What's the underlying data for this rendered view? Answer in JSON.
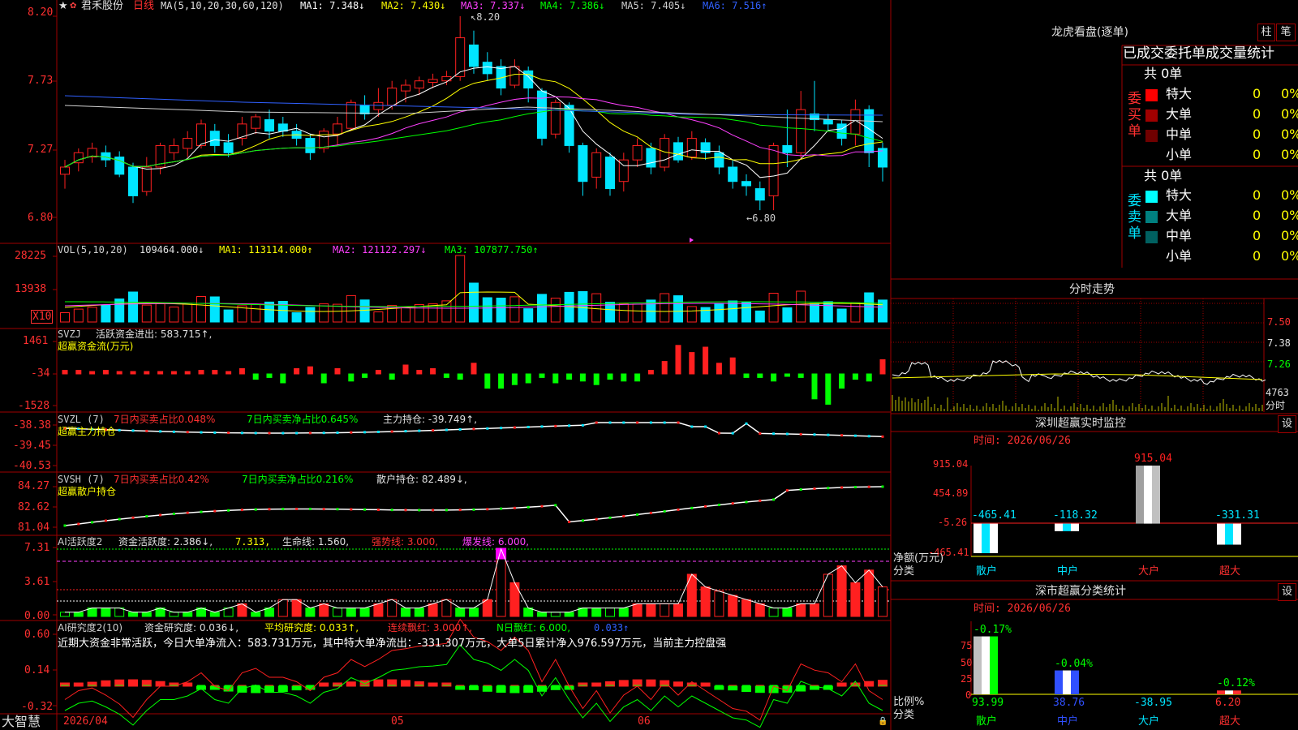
{
  "colors": {
    "up": "#ff2020",
    "down": "#00e5ff",
    "ma1": "#ffffff",
    "ma2": "#ffff00",
    "ma3": "#ff40ff",
    "ma4": "#00ff00",
    "ma5": "#d0d0d0",
    "ma6": "#3060ff",
    "grid": "#a00000",
    "axis_text": "#ff3030",
    "green": "#00ff00"
  },
  "kline": {
    "header": {
      "stock_name": "君禾股份",
      "period": "日线",
      "ma_spec": "MA(5,10,20,30,60,120)",
      "ma1": "MA1: 7.348↓",
      "ma2": "MA2: 7.430↓",
      "ma3": "MA3: 7.337↓",
      "ma4": "MA4: 7.386↓",
      "ma5": "MA5: 7.405↓",
      "ma6": "MA6: 7.516↑"
    },
    "y_ticks": [
      "8.20",
      "7.73",
      "7.27",
      "6.80"
    ],
    "high_label": "8.20",
    "low_label": "6.80",
    "x_labels": [
      "2026/04",
      "05",
      "06"
    ],
    "footer_left": "大智慧"
  },
  "vol": {
    "header": "VOL(5,10,20)",
    "value": "109464.000↓",
    "ma1": "MA1: 113114.000↑",
    "ma2": "MA2: 121122.297↓",
    "ma3": "MA3: 107877.750↑",
    "y_ticks": [
      "28225",
      "13938"
    ],
    "unit": "X10"
  },
  "svzj": {
    "header": "SVZJ",
    "line1": "活跃资金进出: 583.715↑,",
    "line2": "超赢资金流(万元)",
    "y_ticks": [
      "1461",
      "-34",
      "-1528"
    ]
  },
  "svzl": {
    "header": "SVZL (7)",
    "a": "7日内买卖占比0.048%",
    "b": "7日内买卖净占比0.645%",
    "c": "主力持仓: -39.749↑,",
    "line2": "超赢主力持仓",
    "y_ticks": [
      "-38.38",
      "-39.45",
      "-40.53"
    ]
  },
  "svsh": {
    "header": "SVSH (7)",
    "a": "7日内买卖占比0.42%",
    "b": "7日内买卖净占比0.216%",
    "c": "散户持仓: 82.489↓,",
    "line2": "超赢散户持仓",
    "y_ticks": [
      "84.27",
      "82.62",
      "81.04"
    ]
  },
  "ai1": {
    "header": "AI活跃度2",
    "a": "资金活跃度: 2.386↓,",
    "b": "7.313,",
    "c": "生命线: 1.560,",
    "d": "强势线: 3.000,",
    "e": "爆发线: 6.000,",
    "y_ticks": [
      "7.31",
      "3.61",
      "0.00"
    ]
  },
  "ai2": {
    "header": "AI研究度2(10)",
    "a": "资金研究度: 0.036↓,",
    "b": "平均研究度: 0.033↑,",
    "c": "连续飘红: 3.000↑,",
    "d": "N日飘红: 6.000,",
    "e": "0.033↑",
    "summary": "近期大资金非常活跃，今日大单净流入：583.731万元，其中特大单净流出：-331.307万元，大单5日累计净入976.597万元，当前主力控盘强",
    "y_ticks": [
      "0.60",
      "0.14",
      "-0.32"
    ]
  },
  "right": {
    "lhb_title": "龙虎看盘(逐单)",
    "btn_bar": "柱",
    "btn_pen": "笔",
    "tabs_title": "已成交委托单成交量统计",
    "buy_label": "委买单",
    "sell_label": "委卖单",
    "buy_total": "共 0单",
    "sell_total": "共 0单",
    "buy_rows": [
      {
        "name": "特大",
        "count": "0",
        "pct": "0%",
        "color": "#ff0000"
      },
      {
        "name": "大单",
        "count": "0",
        "pct": "0%",
        "color": "#a00000"
      },
      {
        "name": "中单",
        "count": "0",
        "pct": "0%",
        "color": "#700000"
      },
      {
        "name": "小单",
        "count": "0",
        "pct": "0%",
        "color": ""
      }
    ],
    "sell_rows": [
      {
        "name": "特大",
        "count": "0",
        "pct": "0%",
        "color": "#00ffff"
      },
      {
        "name": "大单",
        "count": "0",
        "pct": "0%",
        "color": "#008080"
      },
      {
        "name": "中单",
        "count": "0",
        "pct": "0%",
        "color": "#006060"
      },
      {
        "name": "小单",
        "count": "0",
        "pct": "0%",
        "color": ""
      }
    ],
    "fenshi_title": "分时走势",
    "fenshi_ticks": [
      "7.50",
      "7.38",
      "7.26"
    ],
    "fenshi_vol": "4763",
    "fenshi_unit": "分时",
    "monitor_title": "深圳超赢实时监控",
    "monitor_btn": "设",
    "monitor_time": "时间: 2026/06/26",
    "monitor_ticks": [
      "915.04",
      "454.89",
      "-5.26",
      "-465.41"
    ],
    "monitor_axis1": "净额(万元)",
    "monitor_axis2": "分类",
    "monitor_bars": [
      {
        "cat": "散户",
        "value": -465.41,
        "label": "-465.41"
      },
      {
        "cat": "中户",
        "value": -118.32,
        "label": "-118.32"
      },
      {
        "cat": "大户",
        "value": 915.04,
        "label": "915.04"
      },
      {
        "cat": "超大",
        "value": -331.31,
        "label": "-331.31"
      }
    ],
    "stats_title": "深市超赢分类统计",
    "stats_btn": "设",
    "stats_time": "时间: 2026/06/26",
    "stats_ticks": [
      "75",
      "50",
      "25",
      "0"
    ],
    "stats_axis1": "比例%",
    "stats_axis2": "分类",
    "stats_bars": [
      {
        "cat": "散户",
        "value": 93.99,
        "top": "-0.17%",
        "bottom": "93.99"
      },
      {
        "cat": "中户",
        "value": 38.76,
        "top": "-0.04%",
        "bottom": "38.76"
      },
      {
        "cat": "大户",
        "value": -38.95,
        "top": "",
        "bottom": "-38.95"
      },
      {
        "cat": "超大",
        "value": 6.2,
        "top": "-0.12%",
        "bottom": "6.20"
      }
    ]
  },
  "chart_data": {
    "type": "candlestick",
    "title": "君禾股份 日线",
    "ylim": [
      6.8,
      8.2
    ],
    "x_labels": [
      "2026/04",
      "05",
      "06"
    ],
    "candles": [
      [
        7.1,
        7.15,
        7.0,
        7.2
      ],
      [
        7.18,
        7.25,
        7.12,
        7.28
      ],
      [
        7.22,
        7.28,
        7.18,
        7.32
      ],
      [
        7.25,
        7.2,
        7.15,
        7.3
      ],
      [
        7.22,
        7.1,
        7.08,
        7.26
      ],
      [
        7.15,
        6.95,
        6.9,
        7.18
      ],
      [
        6.98,
        7.15,
        6.95,
        7.22
      ],
      [
        7.15,
        7.3,
        7.1,
        7.32
      ],
      [
        7.25,
        7.3,
        7.2,
        7.35
      ],
      [
        7.28,
        7.35,
        7.22,
        7.4
      ],
      [
        7.3,
        7.45,
        7.28,
        7.48
      ],
      [
        7.4,
        7.3,
        7.25,
        7.45
      ],
      [
        7.32,
        7.25,
        7.22,
        7.38
      ],
      [
        7.35,
        7.45,
        7.3,
        7.5
      ],
      [
        7.42,
        7.5,
        7.38,
        7.52
      ],
      [
        7.48,
        7.4,
        7.35,
        7.55
      ],
      [
        7.45,
        7.4,
        7.36,
        7.5
      ],
      [
        7.4,
        7.35,
        7.3,
        7.45
      ],
      [
        7.35,
        7.25,
        7.2,
        7.38
      ],
      [
        7.28,
        7.4,
        7.25,
        7.42
      ],
      [
        7.38,
        7.45,
        7.3,
        7.5
      ],
      [
        7.42,
        7.6,
        7.4,
        7.62
      ],
      [
        7.58,
        7.52,
        7.48,
        7.65
      ],
      [
        7.55,
        7.6,
        7.5,
        7.7
      ],
      [
        7.58,
        7.7,
        7.55,
        7.75
      ],
      [
        7.68,
        7.72,
        7.6,
        7.76
      ],
      [
        7.7,
        7.75,
        7.65,
        7.78
      ],
      [
        7.74,
        7.76,
        7.7,
        7.8
      ],
      [
        7.75,
        7.78,
        7.72,
        7.82
      ],
      [
        7.78,
        8.05,
        7.75,
        8.2
      ],
      [
        8.0,
        7.85,
        7.8,
        8.1
      ],
      [
        7.88,
        7.8,
        7.75,
        7.95
      ],
      [
        7.85,
        7.7,
        7.65,
        7.9
      ],
      [
        7.72,
        7.85,
        7.7,
        7.9
      ],
      [
        7.82,
        7.7,
        7.6,
        7.85
      ],
      [
        7.68,
        7.35,
        7.3,
        7.7
      ],
      [
        7.38,
        7.6,
        7.35,
        7.62
      ],
      [
        7.58,
        7.3,
        7.25,
        7.6
      ],
      [
        7.3,
        7.05,
        6.95,
        7.32
      ],
      [
        7.08,
        7.25,
        7.0,
        7.28
      ],
      [
        7.22,
        7.0,
        6.95,
        7.25
      ],
      [
        7.05,
        7.2,
        6.98,
        7.25
      ],
      [
        7.2,
        7.3,
        7.15,
        7.35
      ],
      [
        7.28,
        7.15,
        7.1,
        7.32
      ],
      [
        7.15,
        7.35,
        7.12,
        7.38
      ],
      [
        7.32,
        7.2,
        7.18,
        7.36
      ],
      [
        7.22,
        7.35,
        7.2,
        7.4
      ],
      [
        7.32,
        7.25,
        7.2,
        7.35
      ],
      [
        7.25,
        7.15,
        7.1,
        7.3
      ],
      [
        7.15,
        7.05,
        7.0,
        7.2
      ],
      [
        7.05,
        7.02,
        6.95,
        7.1
      ],
      [
        7.0,
        6.92,
        6.85,
        7.05
      ],
      [
        6.95,
        7.3,
        6.85,
        7.32
      ],
      [
        7.3,
        7.25,
        7.15,
        7.55
      ],
      [
        7.25,
        7.55,
        7.2,
        7.68
      ],
      [
        7.52,
        7.48,
        7.4,
        7.75
      ],
      [
        7.48,
        7.45,
        7.4,
        7.52
      ],
      [
        7.45,
        7.35,
        7.3,
        7.48
      ],
      [
        7.38,
        7.55,
        7.3,
        7.62
      ],
      [
        7.55,
        7.25,
        7.15,
        7.58
      ],
      [
        7.28,
        7.15,
        7.05,
        7.32
      ]
    ]
  }
}
